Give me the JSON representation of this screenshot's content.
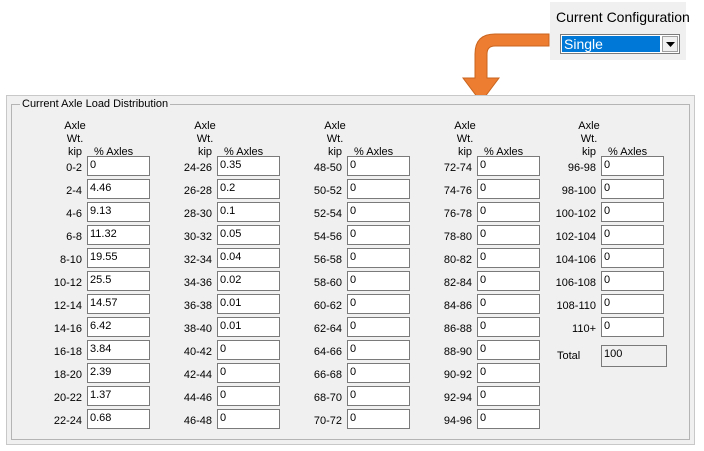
{
  "config": {
    "label": "Current Configuration",
    "value": "Single"
  },
  "group": {
    "title": "Current Axle Load Distribution"
  },
  "header": {
    "axle_label": [
      "Axle",
      "Wt.",
      "kip"
    ],
    "pct_label": "% Axles"
  },
  "columns": [
    {
      "rows": [
        {
          "range": "0-2",
          "value": "0"
        },
        {
          "range": "2-4",
          "value": "4.46"
        },
        {
          "range": "4-6",
          "value": "9.13"
        },
        {
          "range": "6-8",
          "value": "11.32"
        },
        {
          "range": "8-10",
          "value": "19.55"
        },
        {
          "range": "10-12",
          "value": "25.5"
        },
        {
          "range": "12-14",
          "value": "14.57"
        },
        {
          "range": "14-16",
          "value": "6.42"
        },
        {
          "range": "16-18",
          "value": "3.84"
        },
        {
          "range": "18-20",
          "value": "2.39"
        },
        {
          "range": "20-22",
          "value": "1.37"
        },
        {
          "range": "22-24",
          "value": "0.68"
        }
      ]
    },
    {
      "rows": [
        {
          "range": "24-26",
          "value": "0.35"
        },
        {
          "range": "26-28",
          "value": "0.2"
        },
        {
          "range": "28-30",
          "value": "0.1"
        },
        {
          "range": "30-32",
          "value": "0.05"
        },
        {
          "range": "32-34",
          "value": "0.04"
        },
        {
          "range": "34-36",
          "value": "0.02"
        },
        {
          "range": "36-38",
          "value": "0.01"
        },
        {
          "range": "38-40",
          "value": "0.01"
        },
        {
          "range": "40-42",
          "value": "0"
        },
        {
          "range": "42-44",
          "value": "0"
        },
        {
          "range": "44-46",
          "value": "0"
        },
        {
          "range": "46-48",
          "value": "0"
        }
      ]
    },
    {
      "rows": [
        {
          "range": "48-50",
          "value": "0"
        },
        {
          "range": "50-52",
          "value": "0"
        },
        {
          "range": "52-54",
          "value": "0"
        },
        {
          "range": "54-56",
          "value": "0"
        },
        {
          "range": "56-58",
          "value": "0"
        },
        {
          "range": "58-60",
          "value": "0"
        },
        {
          "range": "60-62",
          "value": "0"
        },
        {
          "range": "62-64",
          "value": "0"
        },
        {
          "range": "64-66",
          "value": "0"
        },
        {
          "range": "66-68",
          "value": "0"
        },
        {
          "range": "68-70",
          "value": "0"
        },
        {
          "range": "70-72",
          "value": "0"
        }
      ]
    },
    {
      "rows": [
        {
          "range": "72-74",
          "value": "0"
        },
        {
          "range": "74-76",
          "value": "0"
        },
        {
          "range": "76-78",
          "value": "0"
        },
        {
          "range": "78-80",
          "value": "0"
        },
        {
          "range": "80-82",
          "value": "0"
        },
        {
          "range": "82-84",
          "value": "0"
        },
        {
          "range": "84-86",
          "value": "0"
        },
        {
          "range": "86-88",
          "value": "0"
        },
        {
          "range": "88-90",
          "value": "0"
        },
        {
          "range": "90-92",
          "value": "0"
        },
        {
          "range": "92-94",
          "value": "0"
        },
        {
          "range": "94-96",
          "value": "0"
        }
      ]
    },
    {
      "rows": [
        {
          "range": "96-98",
          "value": "0"
        },
        {
          "range": "98-100",
          "value": "0"
        },
        {
          "range": "100-102",
          "value": "0"
        },
        {
          "range": "102-104",
          "value": "0"
        },
        {
          "range": "104-106",
          "value": "0"
        },
        {
          "range": "106-108",
          "value": "0"
        },
        {
          "range": "108-110",
          "value": "0"
        },
        {
          "range": "110+",
          "value": "0"
        }
      ]
    }
  ],
  "total": {
    "label": "Total",
    "value": "100"
  },
  "colors": {
    "arrow": "#ed7d31",
    "selection": "#0078d7",
    "panel": "#f0f0f0"
  },
  "icons": {
    "dropdown": "chevron-down-icon",
    "arrow": "curved-arrow-icon"
  }
}
